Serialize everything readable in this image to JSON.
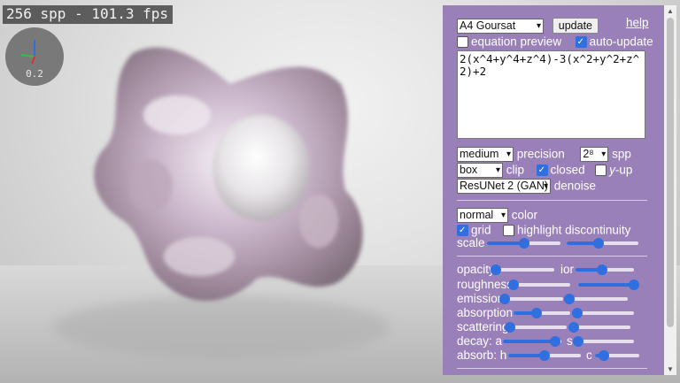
{
  "stats": "256 spp - 101.3 fps",
  "axes_scale": "0.2",
  "panel": {
    "preset": "A4 Goursat",
    "update_label": "update",
    "help_label": "help",
    "equation_preview": {
      "label": "equation preview",
      "checked": false
    },
    "auto_update": {
      "label": "auto-update",
      "checked": true
    },
    "formula": "2(x^4+y^4+z^4)-3(x^2+y^2+z^2)+2",
    "precision": {
      "value": "medium",
      "label": "precision"
    },
    "spp": {
      "value": "2⁸",
      "label": "spp"
    },
    "clip": {
      "value": "box",
      "label": "clip"
    },
    "closed": {
      "label": "closed",
      "checked": true
    },
    "y_up": {
      "label_italic": "y",
      "label": "-up",
      "checked": false
    },
    "denoise": {
      "value": "ResUNet 2 (GAN)",
      "label": "denoise"
    },
    "color": {
      "value": "normal",
      "label": "color"
    },
    "grid": {
      "label": "grid",
      "checked": true
    },
    "highlight_discontinuity": {
      "label": "highlight discontinuity",
      "checked": false
    },
    "scale_label": "scale",
    "opacity_label": "opacity",
    "ior_label": "ior",
    "roughness_label": "roughness",
    "emission_label": "emission",
    "absorption_label": "absorption",
    "scattering_label": "scattering",
    "decay_label": "decay: a",
    "decay_s_label": "s",
    "absorb_label": "absorb: h",
    "absorb_c_label": "c",
    "sliders": {
      "scale_a": 0.5,
      "scale_b": 0.45,
      "opacity": 0.0,
      "ior": 0.45,
      "roughness": 0.0,
      "roughness_b": 1.0,
      "emission": 0.0,
      "emission_b": 0.0,
      "absorption": 0.4,
      "absorption_b": 0.0,
      "scattering": 0.0,
      "scattering_b": 0.0,
      "decay_a": 0.9,
      "decay_s": 0.0,
      "absorb_h": 0.5,
      "absorb_c": 0.2
    }
  },
  "colors": {
    "panel": "#9a80b8",
    "accent": "#2f6fe0"
  }
}
